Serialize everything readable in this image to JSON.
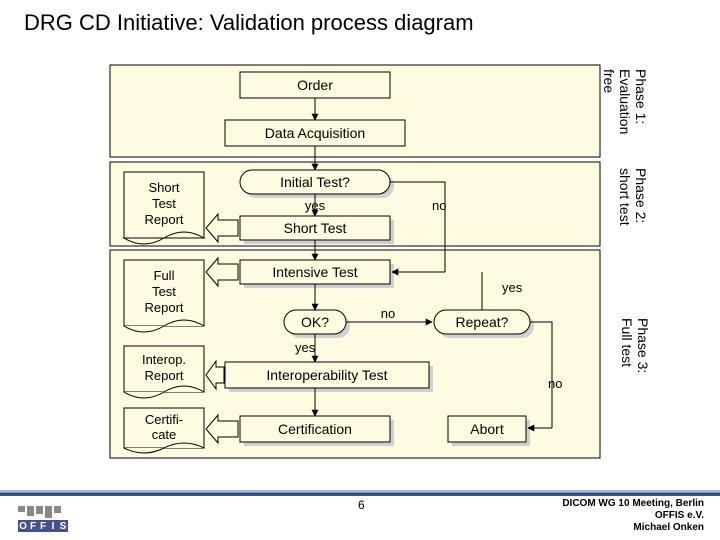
{
  "title": "DRG CD Initiative: Validation process diagram",
  "boxes": {
    "order": "Order",
    "data_acq": "Data Acquisition",
    "initial_test": "Initial Test?",
    "short_test": "Short Test",
    "short_report": "Short\nTest\nReport",
    "intensive": "Intensive Test",
    "ok": "OK?",
    "repeat": "Repeat?",
    "interop": "Interoperability Test",
    "cert": "Certification",
    "abort": "Abort",
    "full_report": "Full\nTest\nReport",
    "interop_report": "Interop.\nReport",
    "certificate": "Certifi-\ncate"
  },
  "labels": {
    "yes_initial": "yes",
    "no_initial": "no",
    "yes_repeat": "yes",
    "no_repeat": "no",
    "yes_ok": "yes",
    "no_ok": "no"
  },
  "phases": {
    "p1a": "Phase 1:",
    "p1b": "Evaluation",
    "p1c": "free",
    "p2a": "Phase 2:",
    "p2b": "short test",
    "p3a": "Phase 3:",
    "p3b": "Full test"
  },
  "footer": {
    "line1": "DICOM WG 10 Meeting, Berlin",
    "line2": "OFFIS e.V.",
    "line3": "Michael Onken"
  },
  "page": "6",
  "offis": [
    "O",
    "F",
    "F",
    "I",
    "S"
  ]
}
